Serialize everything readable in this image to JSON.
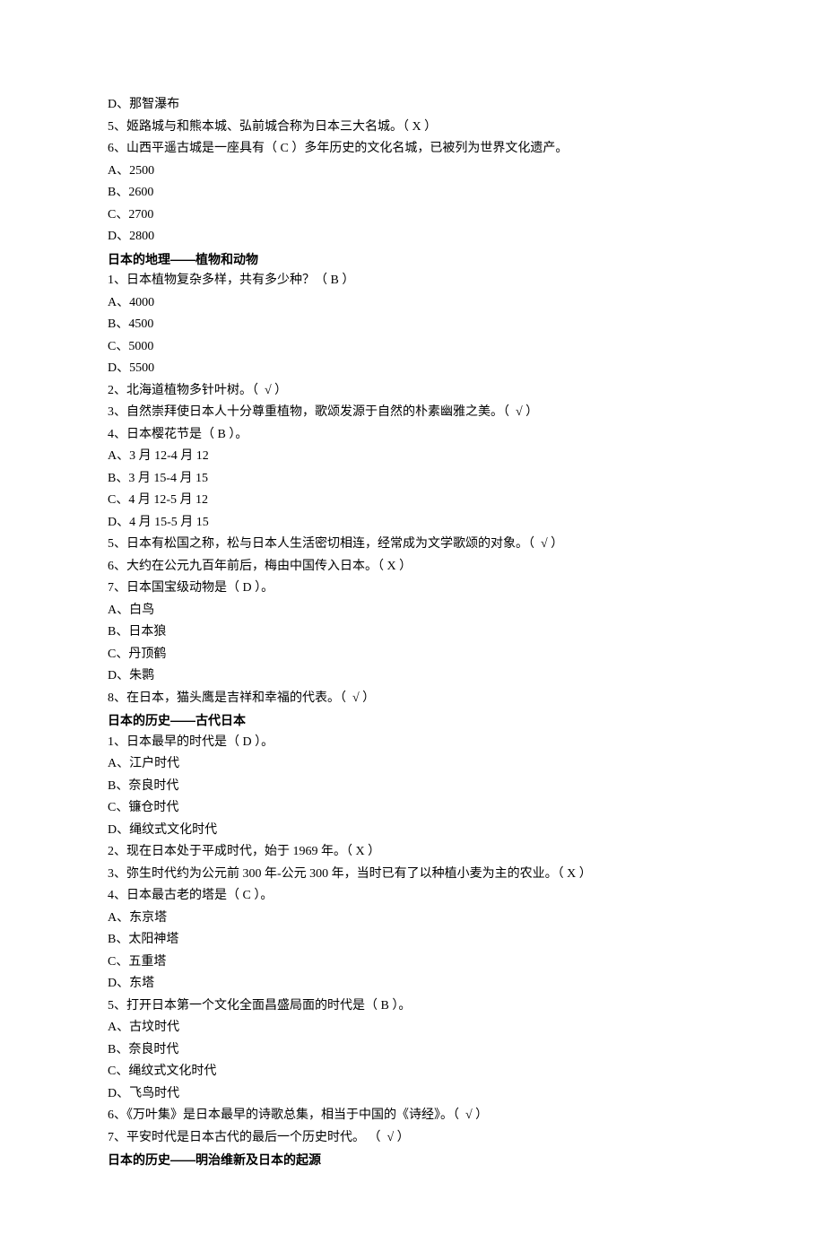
{
  "lines": [
    {
      "text": "D、那智瀑布",
      "bold": false
    },
    {
      "text": "5、姬路城与和熊本城、弘前城合称为日本三大名城。（ X ）",
      "bold": false
    },
    {
      "text": "6、山西平遥古城是一座具有（ C ）多年历史的文化名城，已被列为世界文化遗产。",
      "bold": false
    },
    {
      "text": "A、2500",
      "bold": false
    },
    {
      "text": "B、2600",
      "bold": false
    },
    {
      "text": "C、2700",
      "bold": false
    },
    {
      "text": "D、2800",
      "bold": false
    },
    {
      "text": "日本的地理——植物和动物",
      "bold": true
    },
    {
      "text": "1、日本植物复杂多样，共有多少种？（ B ）",
      "bold": false
    },
    {
      "text": "A、4000",
      "bold": false
    },
    {
      "text": "B、4500",
      "bold": false
    },
    {
      "text": "C、5000",
      "bold": false
    },
    {
      "text": "D、5500",
      "bold": false
    },
    {
      "text": "2、北海道植物多针叶树。（  √ ）",
      "bold": false
    },
    {
      "text": "3、自然崇拜使日本人十分尊重植物，歌颂发源于自然的朴素幽雅之美。（  √ ）",
      "bold": false
    },
    {
      "text": "4、日本樱花节是（ B ）。",
      "bold": false
    },
    {
      "text": "A、3 月 12-4 月 12",
      "bold": false
    },
    {
      "text": "B、3 月 15-4 月 15",
      "bold": false
    },
    {
      "text": "C、4 月 12-5 月 12",
      "bold": false
    },
    {
      "text": "D、4 月 15-5 月 15",
      "bold": false
    },
    {
      "text": "5、日本有松国之称，松与日本人生活密切相连，经常成为文学歌颂的对象。（  √ ）",
      "bold": false
    },
    {
      "text": "6、大约在公元九百年前后，梅由中国传入日本。（ X ）",
      "bold": false
    },
    {
      "text": "7、日本国宝级动物是（ D ）。",
      "bold": false
    },
    {
      "text": "A、白鸟",
      "bold": false
    },
    {
      "text": "B、日本狼",
      "bold": false
    },
    {
      "text": "C、丹顶鹤",
      "bold": false
    },
    {
      "text": "D、朱鹮",
      "bold": false
    },
    {
      "text": "8、在日本，猫头鹰是吉祥和幸福的代表。（  √ ）",
      "bold": false
    },
    {
      "text": "日本的历史——古代日本",
      "bold": true
    },
    {
      "text": "1、日本最早的时代是（ D ）。",
      "bold": false
    },
    {
      "text": "A、江户时代",
      "bold": false
    },
    {
      "text": "B、奈良时代",
      "bold": false
    },
    {
      "text": "C、镰仓时代",
      "bold": false
    },
    {
      "text": "D、绳纹式文化时代",
      "bold": false
    },
    {
      "text": "2、现在日本处于平成时代，始于 1969 年。（ X ）",
      "bold": false
    },
    {
      "text": "3、弥生时代约为公元前 300 年-公元 300 年，当时已有了以种植小麦为主的农业。（ X ）",
      "bold": false
    },
    {
      "text": "4、日本最古老的塔是（ C ）。",
      "bold": false
    },
    {
      "text": "A、东京塔",
      "bold": false
    },
    {
      "text": "B、太阳神塔",
      "bold": false
    },
    {
      "text": "C、五重塔",
      "bold": false
    },
    {
      "text": "D、东塔",
      "bold": false
    },
    {
      "text": "5、打开日本第一个文化全面昌盛局面的时代是（ B ）。",
      "bold": false
    },
    {
      "text": "A、古坟时代",
      "bold": false
    },
    {
      "text": "B、奈良时代",
      "bold": false
    },
    {
      "text": "C、绳纹式文化时代",
      "bold": false
    },
    {
      "text": "D、飞鸟时代",
      "bold": false
    },
    {
      "text": "6、《万叶集》是日本最早的诗歌总集，相当于中国的《诗经》。（  √ ）",
      "bold": false
    },
    {
      "text": "7、平安时代是日本古代的最后一个历史时代。 （  √ ）",
      "bold": false
    },
    {
      "text": "日本的历史——明治维新及日本的起源",
      "bold": true
    }
  ]
}
